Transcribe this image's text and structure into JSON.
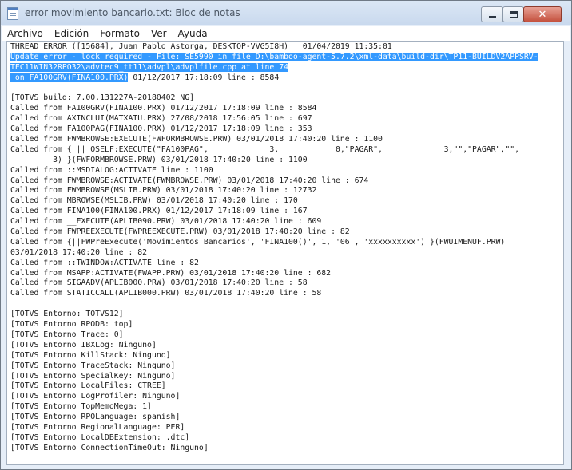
{
  "window": {
    "title": "error movimiento bancario.txt: Bloc de notas",
    "close_glyph": "✕"
  },
  "menu": [
    "Archivo",
    "Edición",
    "Formato",
    "Ver",
    "Ayuda"
  ],
  "document": {
    "lines": [
      {
        "pre": "THREAD ERROR ([15684], Juan Pablo Astorga, DESKTOP-VVG5I8H)   01/04/2019 11:35:01",
        "sel": "",
        "post": ""
      },
      {
        "pre": "",
        "sel": "Update error - lock required - File: SE5990 in file D:\\bamboo-agent-5.7.2\\xml-data\\build-dir\\TP11-BUILDV2APPSRV-",
        "post": ""
      },
      {
        "pre": "",
        "sel": "TEC11WIN32RPO32\\advtec9_tt11\\advpl\\advplfile.cpp at line 74",
        "post": ""
      },
      {
        "pre": "",
        "sel": " on FA100GRV(FINA100.PRX)",
        "post": " 01/12/2017 17:18:09 line : 8584"
      },
      {
        "pre": "",
        "sel": "",
        "post": ""
      },
      {
        "pre": "[TOTVS build: 7.00.131227A-20180402 NG]",
        "sel": "",
        "post": ""
      },
      {
        "pre": "Called from FA100GRV(FINA100.PRX) 01/12/2017 17:18:09 line : 8584",
        "sel": "",
        "post": ""
      },
      {
        "pre": "Called from AXINCLUI(MATXATU.PRX) 27/08/2018 17:56:05 line : 697",
        "sel": "",
        "post": ""
      },
      {
        "pre": "Called from FA100PAG(FINA100.PRX) 01/12/2017 17:18:09 line : 353",
        "sel": "",
        "post": ""
      },
      {
        "pre": "Called from FWMBROWSE:EXECUTE(FWFORMBROWSE.PRW) 03/01/2018 17:40:20 line : 1100",
        "sel": "",
        "post": ""
      },
      {
        "pre": "Called from { || OSELF:EXECUTE(\"FA100PAG\",             3,            0,\"PAGAR\",             3,\"\",\"PAGAR\",\"\",",
        "sel": "",
        "post": ""
      },
      {
        "pre": "         3) }(FWFORMBROWSE.PRW) 03/01/2018 17:40:20 line : 1100",
        "sel": "",
        "post": ""
      },
      {
        "pre": "Called from ::MSDIALOG:ACTIVATE line : 1100",
        "sel": "",
        "post": ""
      },
      {
        "pre": "Called from FWMBROWSE:ACTIVATE(FWMBROWSE.PRW) 03/01/2018 17:40:20 line : 674",
        "sel": "",
        "post": ""
      },
      {
        "pre": "Called from FWMBROWSE(MSLIB.PRW) 03/01/2018 17:40:20 line : 12732",
        "sel": "",
        "post": ""
      },
      {
        "pre": "Called from MBROWSE(MSLIB.PRW) 03/01/2018 17:40:20 line : 170",
        "sel": "",
        "post": ""
      },
      {
        "pre": "Called from FINA100(FINA100.PRX) 01/12/2017 17:18:09 line : 167",
        "sel": "",
        "post": ""
      },
      {
        "pre": "Called from __EXECUTE(APLIB090.PRW) 03/01/2018 17:40:20 line : 609",
        "sel": "",
        "post": ""
      },
      {
        "pre": "Called from FWPREEXECUTE(FWPREEXECUTE.PRW) 03/01/2018 17:40:20 line : 82",
        "sel": "",
        "post": ""
      },
      {
        "pre": "Called from {||FWPreExecute('Movimientos Bancarios', 'FINA100()', 1, '06', 'xxxxxxxxxx') }(FWUIMENUF.PRW)",
        "sel": "",
        "post": ""
      },
      {
        "pre": "03/01/2018 17:40:20 line : 82",
        "sel": "",
        "post": ""
      },
      {
        "pre": "Called from ::TWINDOW:ACTIVATE line : 82",
        "sel": "",
        "post": ""
      },
      {
        "pre": "Called from MSAPP:ACTIVATE(FWAPP.PRW) 03/01/2018 17:40:20 line : 682",
        "sel": "",
        "post": ""
      },
      {
        "pre": "Called from SIGAADV(APLIB000.PRW) 03/01/2018 17:40:20 line : 58",
        "sel": "",
        "post": ""
      },
      {
        "pre": "Called from STATICCALL(APLIB000.PRW) 03/01/2018 17:40:20 line : 58",
        "sel": "",
        "post": ""
      },
      {
        "pre": "",
        "sel": "",
        "post": ""
      },
      {
        "pre": "[TOTVS Entorno: TOTVS12]",
        "sel": "",
        "post": ""
      },
      {
        "pre": "[TOTVS Entorno RPODB: top]",
        "sel": "",
        "post": ""
      },
      {
        "pre": "[TOTVS Entorno Trace: 0]",
        "sel": "",
        "post": ""
      },
      {
        "pre": "[TOTVS Entorno IBXLog: Ninguno]",
        "sel": "",
        "post": ""
      },
      {
        "pre": "[TOTVS Entorno KillStack: Ninguno]",
        "sel": "",
        "post": ""
      },
      {
        "pre": "[TOTVS Entorno TraceStack: Ninguno]",
        "sel": "",
        "post": ""
      },
      {
        "pre": "[TOTVS Entorno SpecialKey: Ninguno]",
        "sel": "",
        "post": ""
      },
      {
        "pre": "[TOTVS Entorno LocalFiles: CTREE]",
        "sel": "",
        "post": ""
      },
      {
        "pre": "[TOTVS Entorno LogProfiler: Ninguno]",
        "sel": "",
        "post": ""
      },
      {
        "pre": "[TOTVS Entorno TopMemoMega: 1]",
        "sel": "",
        "post": ""
      },
      {
        "pre": "[TOTVS Entorno RPOLanguage: spanish]",
        "sel": "",
        "post": ""
      },
      {
        "pre": "[TOTVS Entorno RegionalLanguage: PER]",
        "sel": "",
        "post": ""
      },
      {
        "pre": "[TOTVS Entorno LocalDBExtension: .dtc]",
        "sel": "",
        "post": ""
      },
      {
        "pre": "[TOTVS Entorno ConnectionTimeOut: Ninguno]",
        "sel": "",
        "post": ""
      }
    ]
  }
}
